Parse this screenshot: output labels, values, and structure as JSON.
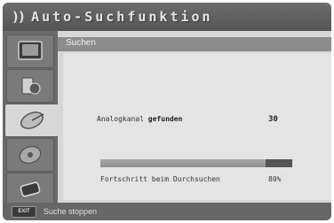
{
  "title": {
    "icon": "broadcast-wave-icon",
    "glyph": "))",
    "text": "Auto-Suchfunktion"
  },
  "sidebar": {
    "items": [
      {
        "icon": "tv-screen-icon",
        "active": false
      },
      {
        "icon": "settings-icon",
        "active": false
      },
      {
        "icon": "satellite-dish-icon",
        "active": true
      },
      {
        "icon": "disc-icon",
        "active": false
      },
      {
        "icon": "hdmi-connector-icon",
        "active": false
      }
    ]
  },
  "panel": {
    "header": "Suchen",
    "found_label_prefix": "Analogkanal ",
    "found_label_bold": "gefunden",
    "found_count": "30",
    "progress_label": "Fortschritt beim Durchsuchen",
    "progress_text": "80%",
    "progress_value": 0.86
  },
  "footer": {
    "key_label": "EXIT",
    "text": "Suche stoppen"
  }
}
